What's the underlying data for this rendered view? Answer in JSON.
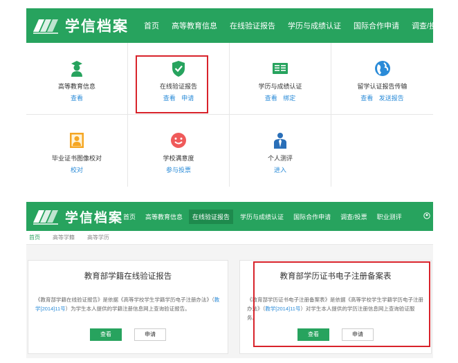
{
  "brand": {
    "name": "学信档案",
    "color": "#27a35e"
  },
  "nav1": {
    "items": [
      "首页",
      "高等教育信息",
      "在线验证报告",
      "学历与成绩认证",
      "国际合作申请",
      "调查/投票"
    ]
  },
  "grid": {
    "cells": [
      {
        "icon": "student-icon",
        "title": "高等教育信息",
        "links": [
          "查看"
        ]
      },
      {
        "icon": "shield-check-icon",
        "title": "在线验证报告",
        "links": [
          "查看",
          "申请"
        ]
      },
      {
        "icon": "book-icon",
        "title": "学历与成绩认证",
        "links": [
          "查看",
          "绑定"
        ]
      },
      {
        "icon": "globe-icon",
        "title": "留学认证报告传输",
        "links": [
          "查看",
          "发送报告"
        ]
      },
      {
        "icon": "portrait-icon",
        "title": "毕业证书图像校对",
        "links": [
          "校对"
        ]
      },
      {
        "icon": "smiley-icon",
        "title": "学校满意度",
        "links": [
          "参与投票"
        ]
      },
      {
        "icon": "person-icon",
        "title": "个人测评",
        "links": [
          "进入"
        ]
      }
    ]
  },
  "nav2": {
    "items": [
      "首页",
      "高等教育信息",
      "在线验证报告",
      "学历与成绩认证",
      "国际合作申请",
      "调查/投票",
      "职业测评"
    ],
    "active_index": 2
  },
  "breadcrumb": [
    "首页",
    "高等学籍",
    "高等学历"
  ],
  "cards": [
    {
      "title": "教育部学籍在线验证报告",
      "text_before": "《教育部学籍在线验证报告》是依据《高等学校学生学籍学历电子注册办法》（",
      "link": "教学[2014]11号",
      "text_after": "）为学生本人提供的学籍注册信息网上查询验证报告。",
      "btn_primary": "查看",
      "btn_secondary": "申请"
    },
    {
      "title": "教育部学历证书电子注册备案表",
      "text_before": "《教育部学历证书电子注册备案表》是依据《高等学校学生学籍学历电子注册办法》（",
      "link": "教学[2014]11号",
      "text_after": "）对学生本人提供的学历注册信息网上查询验证服务。",
      "btn_primary": "查看",
      "btn_secondary": "申请"
    }
  ]
}
